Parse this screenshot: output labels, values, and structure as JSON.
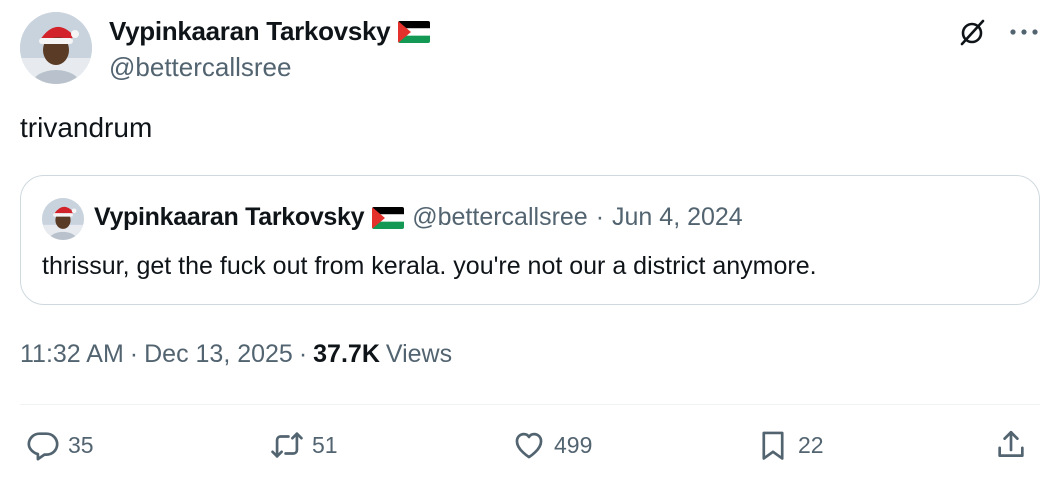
{
  "author": {
    "display_name": "Vypinkaaran Tarkovsky",
    "handle": "@bettercallsree",
    "flag_icon": "palestine-flag-icon"
  },
  "tweet": {
    "text": "trivandrum"
  },
  "quoted": {
    "display_name": "Vypinkaaran Tarkovsky",
    "handle": "@bettercallsree",
    "separator": "·",
    "date": "Jun 4, 2024",
    "text": "thrissur, get the fuck out from kerala. you're not our a district anymore."
  },
  "meta": {
    "time": "11:32 AM",
    "sep1": "·",
    "date": "Dec 13, 2025",
    "sep2": "·",
    "views_count": "37.7K",
    "views_label": "Views"
  },
  "actions": {
    "replies": "35",
    "reposts": "51",
    "likes": "499",
    "bookmarks": "22"
  },
  "colors": {
    "text": "#0f1419",
    "secondary": "#536471",
    "border": "#cfd9de"
  }
}
